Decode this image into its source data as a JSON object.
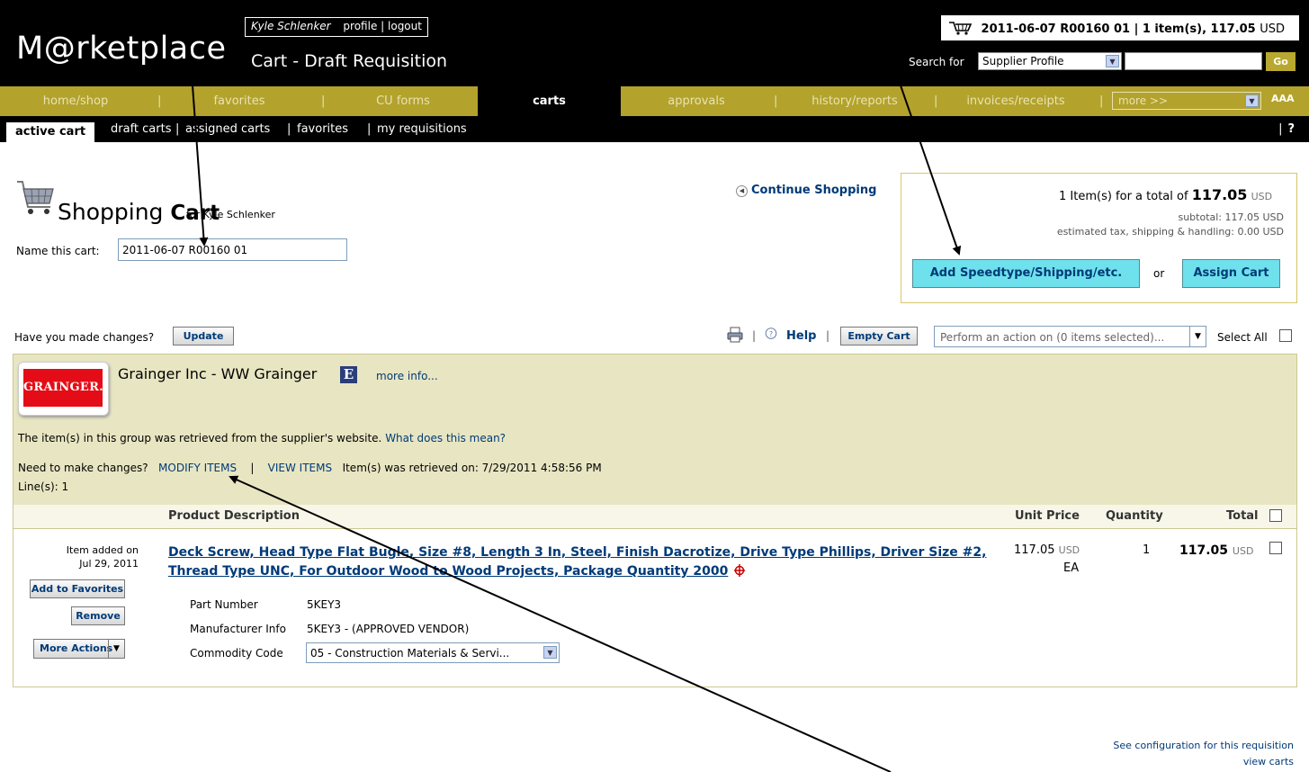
{
  "header": {
    "logo": "M@rketplace",
    "user_name": "Kyle Schlenker",
    "profile_link": "profile",
    "logout_link": "logout",
    "page_title": "Cart - Draft Requisition",
    "cart_summary": "2011-06-07 R00160 01 | 1 item(s), 117.05",
    "cart_summary_currency": "USD",
    "search_label": "Search for",
    "search_type": "Supplier Profile",
    "search_value": "",
    "go_label": "Go"
  },
  "nav": {
    "items": [
      "home/shop",
      "favorites",
      "CU forms",
      "carts",
      "approvals",
      "history/reports",
      "invoices/receipts"
    ],
    "more_label": "more >>",
    "font_size_label": "AAA"
  },
  "subnav": {
    "active": "active cart",
    "items": [
      "draft carts",
      "assigned carts",
      "favorites",
      "my requisitions"
    ],
    "help": "?"
  },
  "cart": {
    "title_prefix": "Shopping ",
    "title_bold": "Cart",
    "for_text": "for Kyle Schlenker",
    "name_label": "Name this cart:",
    "name_value": "2011-06-07 R00160 01",
    "continue_shopping": "Continue Shopping"
  },
  "totals": {
    "items_text": "1 Item(s)  for a total of",
    "total": "117.05",
    "currency": "USD",
    "subtotal_line": "subtotal:  117.05 USD",
    "tax_line": "estimated tax, shipping & handling:     0.00 USD",
    "add_speedtype_label": "Add Speedtype/Shipping/etc.",
    "or_label": "or",
    "assign_cart_label": "Assign Cart"
  },
  "actions": {
    "changes_label": "Have you made changes?",
    "update_label": "Update",
    "help_label": "Help",
    "empty_cart_label": "Empty Cart",
    "action_select": "Perform an action on (0 items selected)...",
    "select_all_label": "Select All"
  },
  "supplier": {
    "logo_text": "GRAINGER.",
    "name": "Grainger Inc - WW Grainger",
    "e_badge": "E",
    "more_info": "more info...",
    "retrieved_text": "The item(s) in this group was retrieved from the supplier's website.",
    "what_mean_link": "What does this mean?",
    "need_changes": "Need to make changes?",
    "modify_items": "MODIFY ITEMS",
    "sep": "|",
    "view_items": "VIEW ITEMS",
    "retrieved_on": "Item(s) was retrieved on: 7/29/2011 4:58:56 PM",
    "lines": "Line(s): 1"
  },
  "table": {
    "headers": {
      "product_description": "Product Description",
      "unit_price": "Unit Price",
      "quantity": "Quantity",
      "total": "Total"
    },
    "row": {
      "added_on_label": "Item added on",
      "added_on_date": "Jul 29, 2011",
      "add_to_favorites": "Add to Favorites",
      "remove": "Remove",
      "more_actions": "More Actions",
      "description": "Deck Screw, Head Type Flat Bugle, Size #8, Length 3 In, Steel, Finish Dacrotize, Drive Type Phillips, Driver Size #2, Thread Type UNC, For Outdoor Wood to Wood Projects, Package Quantity 2000",
      "part_number_label": "Part Number",
      "part_number": "5KEY3",
      "manufacturer_label": "Manufacturer Info",
      "manufacturer": "5KEY3 - (APPROVED VENDOR)",
      "commodity_label": "Commodity Code",
      "commodity_value": "05 - Construction Materials & Servi...",
      "unit_price": "117.05",
      "unit_currency": "USD",
      "uom": "EA",
      "quantity": "1",
      "total": "117.05",
      "total_currency": "USD"
    }
  },
  "footer": {
    "see_config": "See configuration for this requisition",
    "view_carts": "view carts"
  },
  "colors": {
    "header_bg": "#000000",
    "nav_bg": "#b3a22c",
    "supplier_panel_bg": "#e8e6c2",
    "link": "#003a78",
    "cyan_button": "#6fe1ec",
    "grainger_red": "#e40d17"
  }
}
